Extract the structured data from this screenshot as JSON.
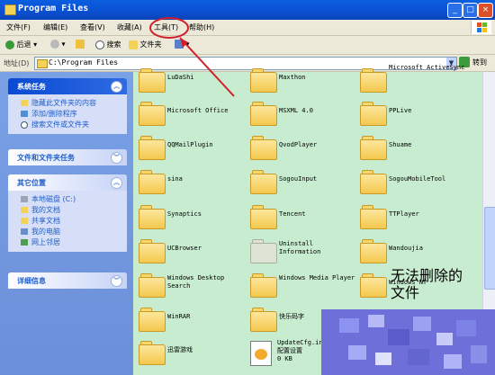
{
  "window": {
    "title": "Program Files",
    "minimize": "_",
    "maximize": "□",
    "close": "×"
  },
  "menu": [
    "文件(F)",
    "编辑(E)",
    "查看(V)",
    "收藏(A)",
    "工具(T)",
    "帮助(H)"
  ],
  "toolbar": {
    "back": "后退",
    "search": "搜索",
    "folders": "文件夹"
  },
  "address": {
    "label": "地址(D)",
    "value": "C:\\Program Files",
    "go": "转到"
  },
  "left_panel": {
    "tasks": {
      "title": "系统任务",
      "items": [
        "隐藏此文件夹的内容",
        "添加/删除程序",
        "搜索文件或文件夹"
      ]
    },
    "file_tasks": {
      "title": "文件和文件夹任务"
    },
    "other_places": {
      "title": "其它位置",
      "items": [
        "本地磁盘 (C:)",
        "我的文档",
        "共享文档",
        "我的电脑",
        "网上邻居"
      ]
    },
    "details": {
      "title": "详细信息"
    }
  },
  "files": [
    {
      "name": "LuDaShi"
    },
    {
      "name": "Maxthon"
    },
    {
      "name": "Microsoft ActiveSync"
    },
    {
      "name": "Microsoft Office"
    },
    {
      "name": "MSXML 4.0"
    },
    {
      "name": "PPLive"
    },
    {
      "name": "QQMailPlugin"
    },
    {
      "name": "QvodPlayer"
    },
    {
      "name": "Shuame"
    },
    {
      "name": "sina"
    },
    {
      "name": "SogouInput"
    },
    {
      "name": "SogouMobileTool"
    },
    {
      "name": "Synaptics"
    },
    {
      "name": "Tencent"
    },
    {
      "name": "TTPlayer"
    },
    {
      "name": "UCBrowser"
    },
    {
      "name": "Uninstall Information"
    },
    {
      "name": "Wandoujia"
    },
    {
      "name": "Windows Desktop Search"
    },
    {
      "name": "Windows Media Player"
    },
    {
      "name": "Windows NT"
    },
    {
      "name": "WinRAR"
    },
    {
      "name": "快乐码字"
    },
    {
      "name": "迅雷游戏"
    },
    {
      "name": "UpdateCfg.ini",
      "sub1": "配置设置",
      "sub2": "0 KB"
    }
  ],
  "annotation": {
    "text1": "无法删除的",
    "text2": "文件",
    "color": "#d21f2a"
  }
}
